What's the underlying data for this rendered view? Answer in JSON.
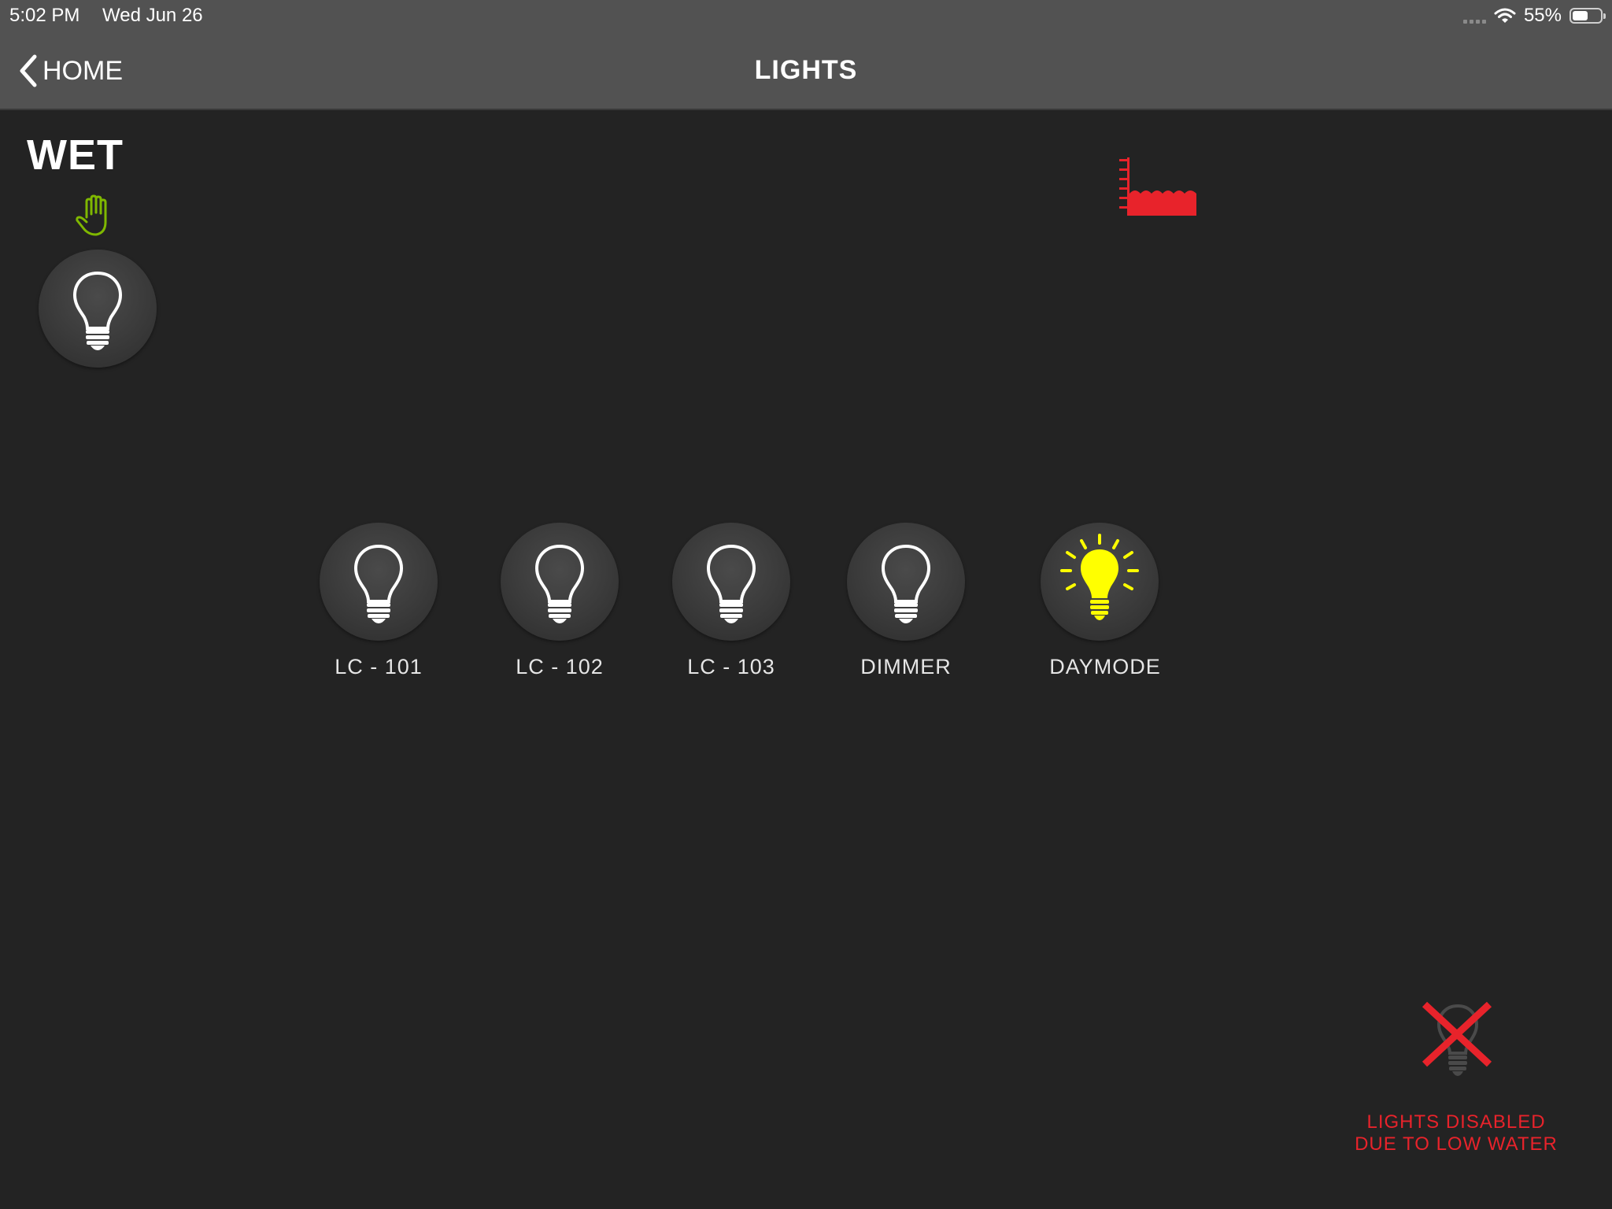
{
  "status_bar": {
    "time": "5:02 PM",
    "date": "Wed Jun 26",
    "battery_percent": "55%",
    "battery_level": 0.55,
    "icons": [
      "signal-dots-icon",
      "wifi-icon",
      "battery-icon"
    ]
  },
  "nav": {
    "back_label": "HOME",
    "title": "LIGHTS"
  },
  "zone": {
    "title": "WET",
    "manual_icon": "hand-icon",
    "master_light_icon": "bulb-outline-icon"
  },
  "lights": [
    {
      "label": "LC - 101",
      "state": "off",
      "icon": "bulb-outline-icon"
    },
    {
      "label": "LC - 102",
      "state": "off",
      "icon": "bulb-outline-icon"
    },
    {
      "label": "LC - 103",
      "state": "off",
      "icon": "bulb-outline-icon"
    },
    {
      "label": "DIMMER",
      "state": "off",
      "icon": "bulb-outline-icon"
    },
    {
      "label": "DAYMODE",
      "state": "on",
      "icon": "bulb-lit-icon"
    }
  ],
  "water_level_icon": "water-level-icon",
  "notice": {
    "line1": "LIGHTS DISABLED",
    "line2": "DUE TO LOW WATER",
    "icon": "disabled-bulb-icon"
  },
  "colors": {
    "background": "#232323",
    "bar": "#525252",
    "accent_red": "#e8232b",
    "lit_yellow": "#ffff00",
    "hand_green": "#7fb800"
  }
}
